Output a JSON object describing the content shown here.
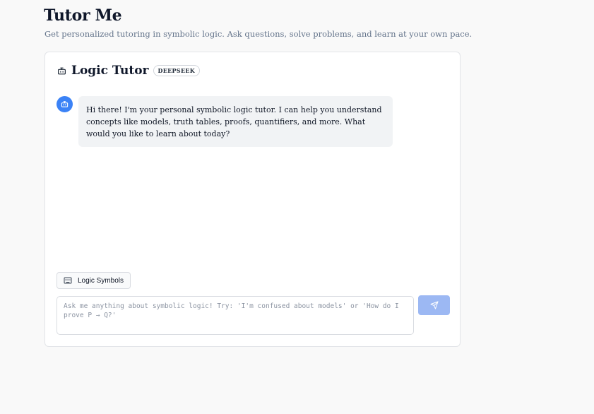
{
  "page": {
    "title": "Tutor Me",
    "subtitle": "Get personalized tutoring in symbolic logic. Ask questions, solve problems, and learn at your own pace."
  },
  "tutor": {
    "title": "Logic Tutor",
    "model_badge": "DEEPSEEK",
    "header_icon": "bot-icon"
  },
  "messages": [
    {
      "role": "assistant",
      "avatar_icon": "bot-icon",
      "text": "Hi there! I'm your personal symbolic logic tutor. I can help you understand concepts like models, truth tables, proofs, quantifiers, and more. What would you like to learn about today?"
    }
  ],
  "composer": {
    "symbols_button_label": "Logic Symbols",
    "symbols_button_icon": "keyboard-icon",
    "input_value": "",
    "input_placeholder": "Ask me anything about symbolic logic! Try: 'I'm confused about models' or 'How do I prove P → Q?'",
    "send_icon": "send-icon"
  },
  "colors": {
    "background": "#f9f9f9",
    "avatar": "#3b82f6",
    "bubble": "#f1f3f5",
    "send_button_disabled": "#9cb8f3",
    "subtitle": "#64748b"
  }
}
